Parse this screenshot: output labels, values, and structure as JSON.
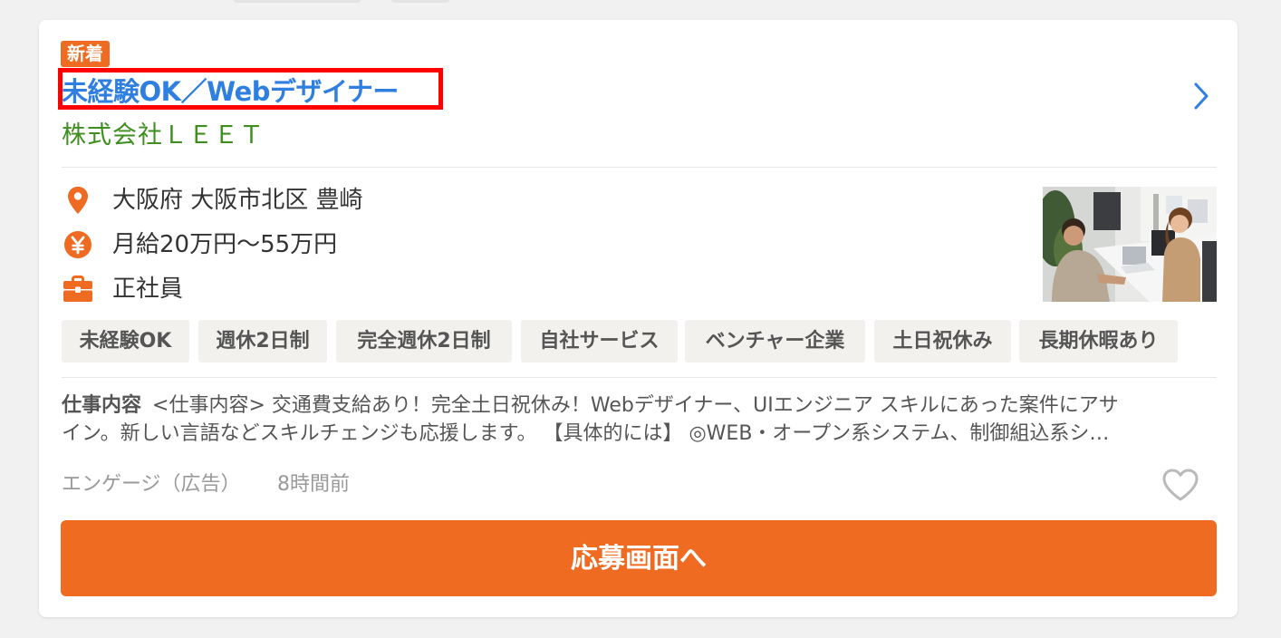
{
  "job": {
    "badge": "新着",
    "title": "未経験OK／Webデザイナー",
    "company": "株式会社ＬＥＥＴ",
    "location": "大阪府 大阪市北区 豊崎",
    "salary": "月給20万円〜55万円",
    "employment_type": "正社員",
    "tags": [
      "未経験OK",
      "週休2日制",
      "完全週休2日制",
      "自社サービス",
      "ベンチャー企業",
      "土日祝休み",
      "長期休暇あり"
    ],
    "description_label": "仕事内容",
    "description_line1": "<仕事内容> 交通費支給あり！完全土日祝休み！Webデザイナー、UIエンジニア スキルにあった案件にアサ",
    "description_line2": "イン。新しい言語などスキルチェンジも応援します。 【具体的には】 ◎WEB・オープン系システム、制御組込系シ…",
    "source": "エンゲージ（広告）",
    "posted": "8時間前",
    "apply_label": "応募画面へ"
  },
  "icons": {
    "location": "map-pin-icon",
    "salary": "yen-coin-icon",
    "employment": "briefcase-icon",
    "favorite": "heart-outline-icon",
    "open_detail": "chevron-right-icon"
  },
  "colors": {
    "accent": "#ee6b21",
    "title_link": "#2f7fe0",
    "company": "#3e8f1f",
    "highlight_box": "#ff0000",
    "tag_bg": "#f2f1ee"
  }
}
